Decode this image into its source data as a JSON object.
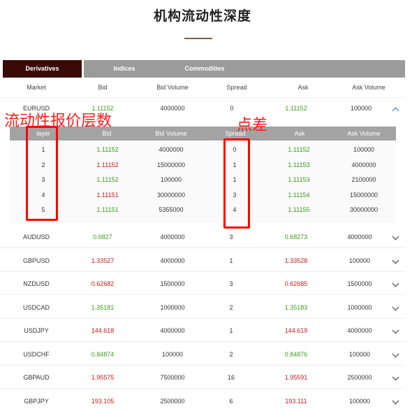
{
  "title": "机构流动性深度",
  "tabs": [
    {
      "label": "Derivatives",
      "active": true
    },
    {
      "label": "Indices",
      "active": false
    },
    {
      "label": "Commodities",
      "active": false
    }
  ],
  "columns": [
    "Market",
    "Bid",
    "Bid Volume",
    "Spread",
    "Ask",
    "Ask Volume"
  ],
  "expanded_row": {
    "market": "EURUSD",
    "bid": "1.11152",
    "bid_dir": "up",
    "bid_volume": "4000000",
    "spread": "0",
    "ask": "1.11152",
    "ask_dir": "up",
    "ask_volume": "100000"
  },
  "depth_columns": [
    "layer",
    "Bid",
    "Bid Volume",
    "Spread",
    "Ask",
    "Ask Volume"
  ],
  "depth_rows": [
    {
      "layer": "1",
      "bid": "1.11152",
      "bid_dir": "up",
      "bid_volume": "4000000",
      "spread": "0",
      "ask": "1.11152",
      "ask_dir": "up",
      "ask_volume": "100000"
    },
    {
      "layer": "2",
      "bid": "1.11152",
      "bid_dir": "down",
      "bid_volume": "15000000",
      "spread": "1",
      "ask": "1.11153",
      "ask_dir": "up",
      "ask_volume": "4000000"
    },
    {
      "layer": "3",
      "bid": "1.11152",
      "bid_dir": "up",
      "bid_volume": "100000",
      "spread": "1",
      "ask": "1.11153",
      "ask_dir": "up",
      "ask_volume": "2100000"
    },
    {
      "layer": "4",
      "bid": "1.11151",
      "bid_dir": "down",
      "bid_volume": "30000000",
      "spread": "3",
      "ask": "1.11154",
      "ask_dir": "up",
      "ask_volume": "15000000"
    },
    {
      "layer": "5",
      "bid": "1.11151",
      "bid_dir": "up",
      "bid_volume": "5355000",
      "spread": "4",
      "ask": "1.11155",
      "ask_dir": "up",
      "ask_volume": "30000000"
    }
  ],
  "rows": [
    {
      "market": "AUDUSD",
      "bid": "0.6827",
      "bid_dir": "up",
      "bid_volume": "4000000",
      "spread": "3",
      "ask": "0.68273",
      "ask_dir": "up",
      "ask_volume": "4000000"
    },
    {
      "market": "GBPUSD",
      "bid": "1.33527",
      "bid_dir": "down",
      "bid_volume": "4000000",
      "spread": "1",
      "ask": "1.33528",
      "ask_dir": "down",
      "ask_volume": "100000"
    },
    {
      "market": "NZDUSD",
      "bid": "0.62682",
      "bid_dir": "down",
      "bid_volume": "1500000",
      "spread": "3",
      "ask": "0.62685",
      "ask_dir": "down",
      "ask_volume": "1500000"
    },
    {
      "market": "USDCAD",
      "bid": "1.35181",
      "bid_dir": "up",
      "bid_volume": "1000000",
      "spread": "2",
      "ask": "1.35183",
      "ask_dir": "up",
      "ask_volume": "1000000"
    },
    {
      "market": "USDJPY",
      "bid": "144.618",
      "bid_dir": "down",
      "bid_volume": "4000000",
      "spread": "1",
      "ask": "144.619",
      "ask_dir": "down",
      "ask_volume": "4000000"
    },
    {
      "market": "USDCHF",
      "bid": "0.84874",
      "bid_dir": "up",
      "bid_volume": "100000",
      "spread": "2",
      "ask": "0.84876",
      "ask_dir": "up",
      "ask_volume": "100000"
    },
    {
      "market": "GBPAUD",
      "bid": "1.95575",
      "bid_dir": "down",
      "bid_volume": "7500000",
      "spread": "16",
      "ask": "1.95591",
      "ask_dir": "down",
      "ask_volume": "2500000"
    },
    {
      "market": "GBPJPY",
      "bid": "193.105",
      "bid_dir": "down",
      "bid_volume": "2500000",
      "spread": "6",
      "ask": "193.111",
      "ask_dir": "down",
      "ask_volume": "100000"
    }
  ],
  "annotations": {
    "depth_label": "流动性报价层数",
    "spread_label": "点差"
  },
  "colors": {
    "up": "#3d9a1d",
    "down": "#c21a1a",
    "tab_active": "#3a0b06",
    "tab_inactive": "#9b9b9b",
    "annotation": "#ff0000"
  }
}
